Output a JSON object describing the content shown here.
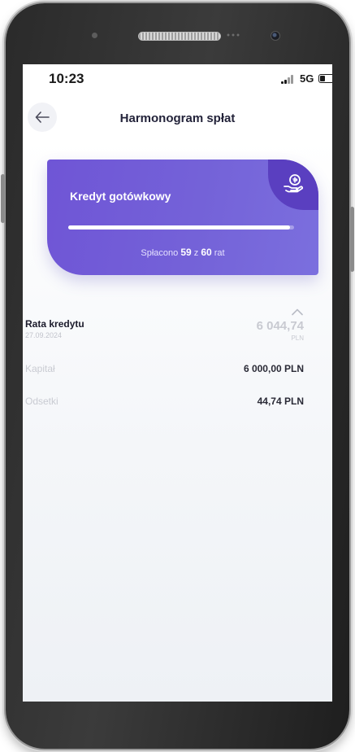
{
  "status_bar": {
    "time": "10:23",
    "network": "5G",
    "battery_level": 0.35
  },
  "header": {
    "title": "Harmonogram spłat",
    "back_icon": "arrow-left-icon"
  },
  "loan_card": {
    "title": "Kredyt gotówkowy",
    "icon": "hand-coin-icon",
    "paid_prefix": "Spłacono",
    "paid_count": "59",
    "paid_separator": "z",
    "total_count": "60",
    "paid_suffix": "rat",
    "progress": 0.983,
    "colors": {
      "card": "#7462d8",
      "corner": "#5a3fc0"
    }
  },
  "installment": {
    "title": "Rata kredytu",
    "date": "27.09.2024",
    "amount": "6 044,74",
    "currency": "PLN",
    "collapse_icon": "chevron-up-icon",
    "rows": [
      {
        "label": "Kapitał",
        "value": "6 000,00 PLN"
      },
      {
        "label": "Odsetki",
        "value": "44,74 PLN"
      }
    ]
  }
}
